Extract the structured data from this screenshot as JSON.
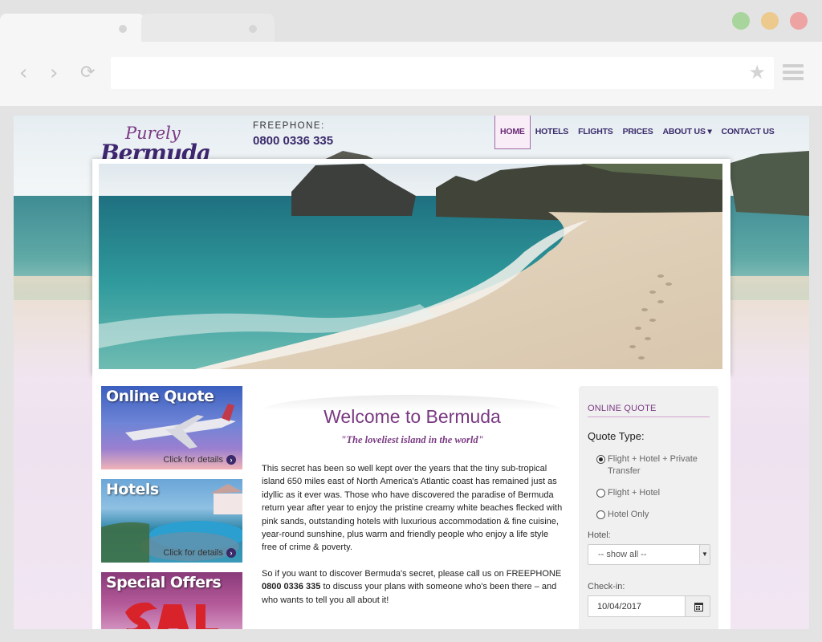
{
  "browser": {
    "window_controls": [
      {
        "name": "minimize",
        "color": "#a7d59b"
      },
      {
        "name": "zoom",
        "color": "#ecc98c"
      },
      {
        "name": "close",
        "color": "#eea3a3"
      }
    ],
    "url": ""
  },
  "site": {
    "logo": {
      "line1": "Purely",
      "line2": "Bermuda"
    },
    "phone": {
      "label": "FREEPHONE:",
      "number": "0800 0336 335"
    },
    "nav": [
      {
        "label": "HOME",
        "active": true
      },
      {
        "label": "HOTELS",
        "active": false
      },
      {
        "label": "FLIGHTS",
        "active": false
      },
      {
        "label": "PRICES",
        "active": false
      },
      {
        "label": "ABOUT US ▾",
        "active": false
      },
      {
        "label": "CONTACT US",
        "active": false
      }
    ],
    "colors": {
      "brand_purple": "#7a3a82",
      "navy": "#3a2a6a",
      "page_pink": "#efe2f0"
    }
  },
  "promos": [
    {
      "title": "Online Quote",
      "cta": "Click for details"
    },
    {
      "title": "Hotels",
      "cta": "Click for details"
    },
    {
      "title": "Special Offers",
      "cta": ""
    }
  ],
  "welcome": {
    "title": "Welcome to Bermuda",
    "tagline": "\"The loveliest island in the world\"",
    "paragraph1": "This secret has been so well kept over the years that the tiny sub-tropical island 650 miles east of North America's Atlantic coast has remained just as idyllic as it ever was. Those who have discovered the paradise of Bermuda return year after year to enjoy the pristine creamy white beaches flecked with pink sands, outstanding hotels with luxurious accommodation & fine cuisine, year-round sunshine, plus warm and friendly people who enjoy a life style free of crime & poverty.",
    "paragraph2_before": "So if you want to discover Bermuda's secret, please call us on FREEPHONE ",
    "paragraph2_phone": "0800 0336 335",
    "paragraph2_after": " to discuss your plans with someone who's been there – and who wants to tell you all about it!"
  },
  "quote_form": {
    "title": "ONLINE QUOTE",
    "type_label": "Quote Type:",
    "options": [
      {
        "label": "Flight + Hotel + Private Transfer",
        "checked": true
      },
      {
        "label": "Flight + Hotel",
        "checked": false
      },
      {
        "label": "Hotel Only",
        "checked": false
      }
    ],
    "hotel_label": "Hotel:",
    "hotel_value": "-- show all --",
    "checkin_label": "Check-in:",
    "checkin_value": "10/04/2017"
  }
}
